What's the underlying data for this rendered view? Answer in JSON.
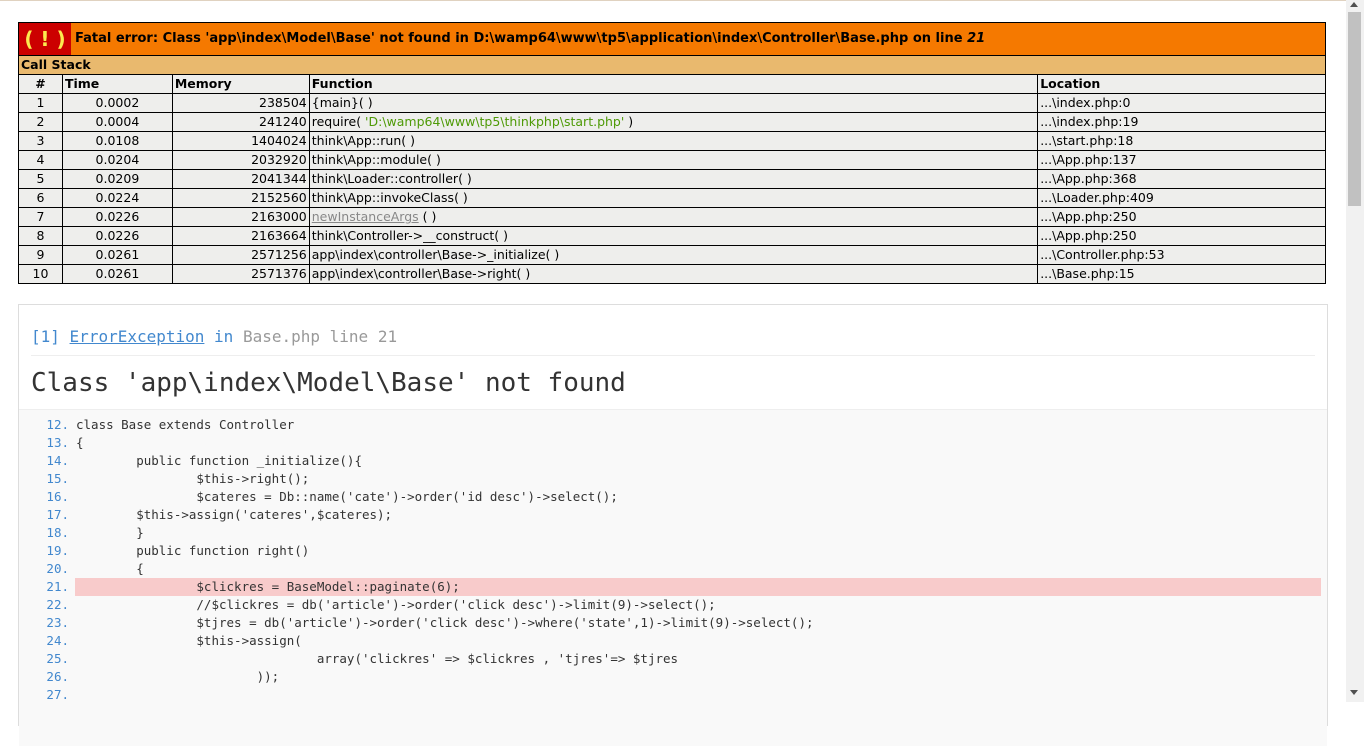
{
  "fatal": {
    "bang": "( ! )",
    "text_prefix": "Fatal error: Class 'app\\index\\Model\\Base' not found in D:\\wamp64\\www\\tp5\\application\\index\\Controller\\Base.php on line ",
    "line": "21"
  },
  "call_stack": {
    "title": "Call Stack",
    "columns": [
      "#",
      "Time",
      "Memory",
      "Function",
      "Location"
    ],
    "rows": [
      {
        "n": "1",
        "time": "0.0002",
        "mem": "238504",
        "fn": "{main}( )",
        "loc": "...\\index.php:0"
      },
      {
        "n": "2",
        "time": "0.0004",
        "mem": "241240",
        "fn": "require( ",
        "arg": "'D:\\wamp64\\www\\tp5\\thinkphp\\start.php'",
        "fn_end": " )",
        "loc": "...\\index.php:19"
      },
      {
        "n": "3",
        "time": "0.0108",
        "mem": "1404024",
        "fn": "think\\App::run( )",
        "loc": "...\\start.php:18"
      },
      {
        "n": "4",
        "time": "0.0204",
        "mem": "2032920",
        "fn": "think\\App::module( )",
        "loc": "...\\App.php:137"
      },
      {
        "n": "5",
        "time": "0.0209",
        "mem": "2041344",
        "fn": "think\\Loader::controller( )",
        "loc": "...\\App.php:368"
      },
      {
        "n": "6",
        "time": "0.0224",
        "mem": "2152560",
        "fn": "think\\App::invokeClass( )",
        "loc": "...\\Loader.php:409"
      },
      {
        "n": "7",
        "time": "0.0226",
        "mem": "2163000",
        "fn_link": "newInstanceArgs",
        "fn_end": " ( )",
        "loc": "...\\App.php:250"
      },
      {
        "n": "8",
        "time": "0.0226",
        "mem": "2163664",
        "fn": "think\\Controller->__construct( )",
        "loc": "...\\App.php:250"
      },
      {
        "n": "9",
        "time": "0.0261",
        "mem": "2571256",
        "fn": "app\\index\\controller\\Base->_initialize( )",
        "loc": "...\\Controller.php:53"
      },
      {
        "n": "10",
        "time": "0.0261",
        "mem": "2571376",
        "fn": "app\\index\\controller\\Base->right( )",
        "loc": "...\\Base.php:15"
      }
    ]
  },
  "exception": {
    "index": "[1]",
    "type": "ErrorException",
    "in_word": "in",
    "file": "Base.php",
    "line_word": "line",
    "line": "21",
    "message": "Class 'app\\index\\Model\\Base' not found"
  },
  "code": {
    "highlight_line": "21.",
    "lines": [
      {
        "no": "12.",
        "text": "class Base extends Controller"
      },
      {
        "no": "13.",
        "text": "{"
      },
      {
        "no": "14.",
        "text": "        public function _initialize(){"
      },
      {
        "no": "15.",
        "text": "                $this->right();"
      },
      {
        "no": "16.",
        "text": "                $cateres = Db::name('cate')->order('id desc')->select();"
      },
      {
        "no": "17.",
        "text": "        $this->assign('cateres',$cateres);"
      },
      {
        "no": "18.",
        "text": "        }"
      },
      {
        "no": "19.",
        "text": "        public function right()"
      },
      {
        "no": "20.",
        "text": "        {"
      },
      {
        "no": "21.",
        "text": "                $clickres = BaseModel::paginate(6);"
      },
      {
        "no": "22.",
        "text": "                //$clickres = db('article')->order('click desc')->limit(9)->select();"
      },
      {
        "no": "23.",
        "text": "                $tjres = db('article')->order('click desc')->where('state',1)->limit(9)->select();"
      },
      {
        "no": "24.",
        "text": "                $this->assign("
      },
      {
        "no": "25.",
        "text": "                                array('clickres' => $clickres , 'tjres'=> $tjres"
      },
      {
        "no": "26.",
        "text": "                        ));"
      },
      {
        "no": "27.",
        "text": ""
      }
    ]
  }
}
